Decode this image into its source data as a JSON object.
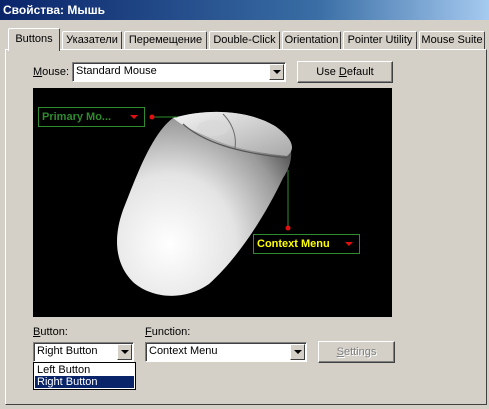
{
  "window": {
    "title": "Свойства: Мышь"
  },
  "tabs": [
    {
      "label": "Buttons",
      "active": true
    },
    {
      "label": "Указатели",
      "active": false
    },
    {
      "label": "Перемещение",
      "active": false
    },
    {
      "label": "Double-Click",
      "active": false
    },
    {
      "label": "Orientation",
      "active": false
    },
    {
      "label": "Pointer Utility",
      "active": false
    },
    {
      "label": "Mouse Suite",
      "active": false
    }
  ],
  "mouse_row": {
    "label_prefix": "M",
    "label_rest": "ouse:",
    "selected": "Standard Mouse",
    "use_default_pre": "Use ",
    "use_default_u": "D",
    "use_default_post": "efault"
  },
  "illustration": {
    "primary_callout": "Primary Mo...",
    "context_callout": "Context Menu",
    "primary_color": "#2e8b2e",
    "context_color": "#ffff00",
    "connector_color": "#2e8b2e",
    "dot_color": "#e01010"
  },
  "button_row": {
    "label_prefix": "B",
    "label_rest": "utton:",
    "selected": "Right Button",
    "options": [
      "Left Button",
      "Right Button"
    ],
    "highlighted_option": "Right Button"
  },
  "function_row": {
    "label_prefix": "F",
    "label_rest": "unction:",
    "selected": "Context Menu",
    "settings_u": "S",
    "settings_rest": "ettings"
  }
}
